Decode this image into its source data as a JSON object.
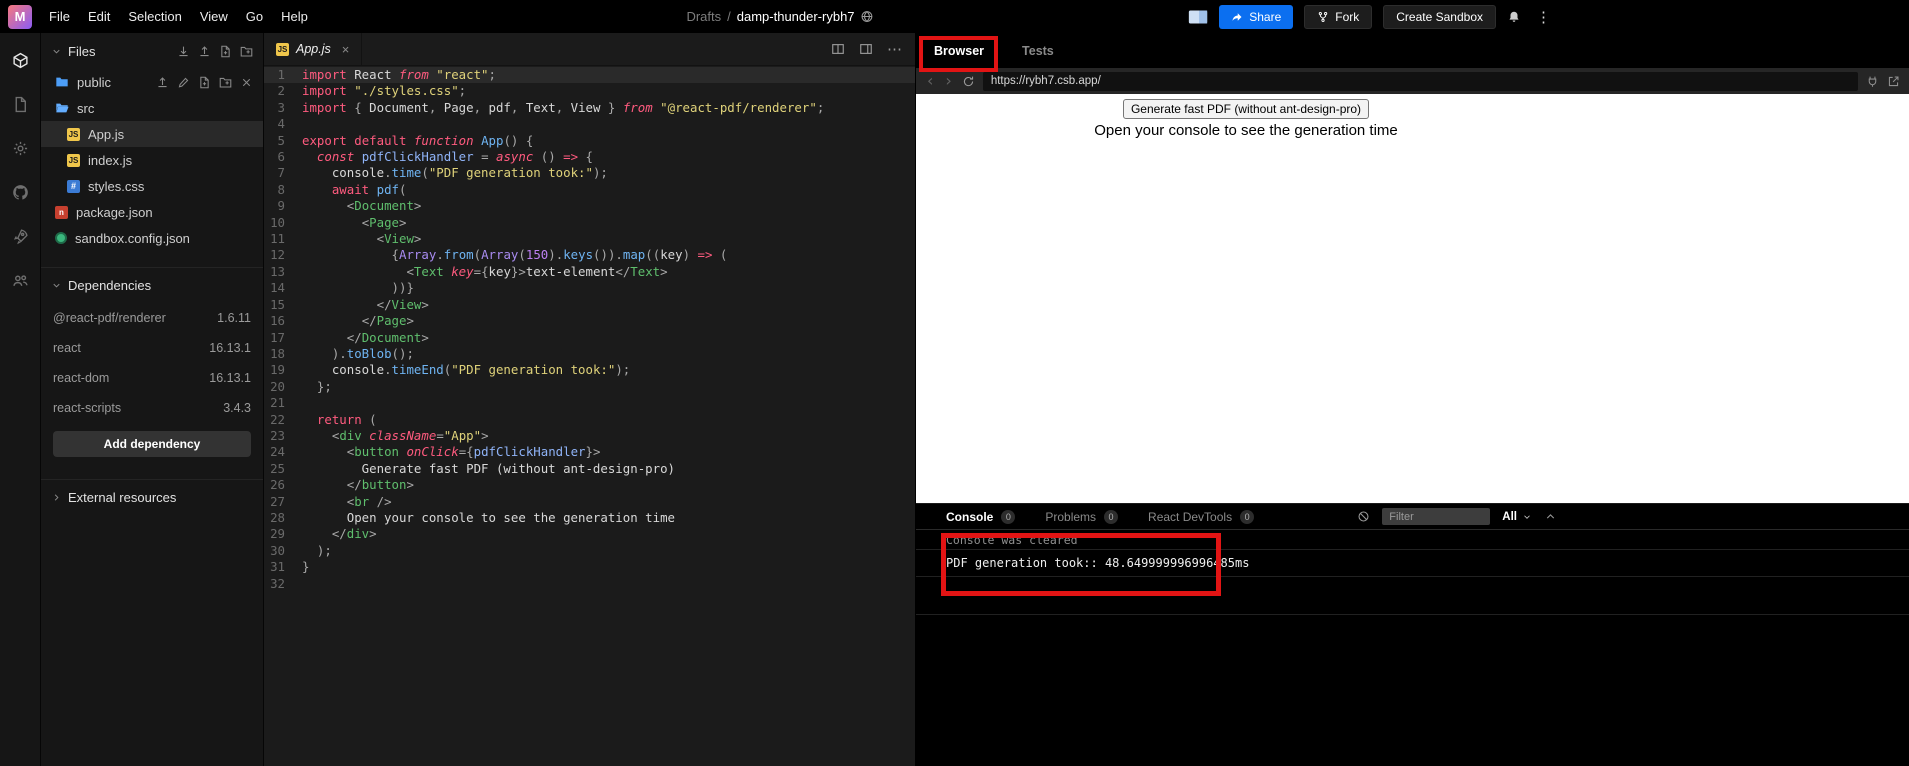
{
  "menubar": {
    "logo_letter": "M",
    "items": [
      "File",
      "Edit",
      "Selection",
      "View",
      "Go",
      "Help"
    ],
    "breadcrumb": {
      "dir": "Drafts",
      "sep": "/",
      "title": "damp-thunder-rybh7"
    },
    "share_label": "Share",
    "fork_label": "Fork",
    "create_sandbox_label": "Create Sandbox"
  },
  "activity_bar": [
    "explorer",
    "files",
    "settings",
    "github",
    "deployment",
    "live"
  ],
  "sidebar": {
    "files_title": "Files",
    "header_actions": [
      "download",
      "upload",
      "new-file",
      "new-folder"
    ],
    "file_row_actions": [
      "upload",
      "rename",
      "new-file",
      "new-folder",
      "delete"
    ],
    "tree": [
      {
        "label": "public",
        "icon": "folder",
        "indent": 0,
        "show_actions": true
      },
      {
        "label": "src",
        "icon": "folder-open",
        "indent": 0
      },
      {
        "label": "App.js",
        "icon": "js",
        "indent": 1,
        "selected": true
      },
      {
        "label": "index.js",
        "icon": "js",
        "indent": 1
      },
      {
        "label": "styles.css",
        "icon": "css",
        "indent": 1
      },
      {
        "label": "package.json",
        "icon": "npm",
        "indent": 0
      },
      {
        "label": "sandbox.config.json",
        "icon": "config",
        "indent": 0
      }
    ],
    "dependencies_title": "Dependencies",
    "dependencies": [
      {
        "name": "@react-pdf/renderer",
        "version": "1.6.11"
      },
      {
        "name": "react",
        "version": "16.13.1"
      },
      {
        "name": "react-dom",
        "version": "16.13.1"
      },
      {
        "name": "react-scripts",
        "version": "3.4.3"
      }
    ],
    "add_dependency_label": "Add dependency",
    "external_resources_title": "External resources"
  },
  "editor": {
    "tab_label": "App.js",
    "line_count": 32,
    "active_line": 1,
    "code": [
      [
        [
          "k",
          "import"
        ],
        [
          "p",
          " React "
        ],
        [
          "ki",
          "from"
        ],
        [
          "p",
          " "
        ],
        [
          "s",
          "\"react\""
        ],
        [
          "d",
          ";"
        ]
      ],
      [
        [
          "k",
          "import"
        ],
        [
          "p",
          " "
        ],
        [
          "s",
          "\"./styles.css\""
        ],
        [
          "d",
          ";"
        ]
      ],
      [
        [
          "k",
          "import"
        ],
        [
          "d",
          " { "
        ],
        [
          "p",
          "Document"
        ],
        [
          "d",
          ", "
        ],
        [
          "p",
          "Page"
        ],
        [
          "d",
          ", "
        ],
        [
          "p",
          "pdf"
        ],
        [
          "d",
          ", "
        ],
        [
          "p",
          "Text"
        ],
        [
          "d",
          ", "
        ],
        [
          "p",
          "View"
        ],
        [
          "d",
          " } "
        ],
        [
          "ki",
          "from"
        ],
        [
          "p",
          " "
        ],
        [
          "s",
          "\"@react-pdf/renderer\""
        ],
        [
          "d",
          ";"
        ]
      ],
      [],
      [
        [
          "k",
          "export"
        ],
        [
          "p",
          " "
        ],
        [
          "k",
          "default"
        ],
        [
          "p",
          " "
        ],
        [
          "ki",
          "function"
        ],
        [
          "p",
          " "
        ],
        [
          "f",
          "App"
        ],
        [
          "d",
          "() {"
        ]
      ],
      [
        [
          "p",
          "  "
        ],
        [
          "ki",
          "const"
        ],
        [
          "p",
          " "
        ],
        [
          "v",
          "pdfClickHandler"
        ],
        [
          "d",
          " = "
        ],
        [
          "ki",
          "async"
        ],
        [
          "d",
          " () "
        ],
        [
          "k",
          "=>"
        ],
        [
          "d",
          " {"
        ]
      ],
      [
        [
          "p",
          "    console"
        ],
        [
          "d",
          "."
        ],
        [
          "f",
          "time"
        ],
        [
          "d",
          "("
        ],
        [
          "s",
          "\"PDF generation took:\""
        ],
        [
          "d",
          ");"
        ]
      ],
      [
        [
          "p",
          "    "
        ],
        [
          "k",
          "await"
        ],
        [
          "p",
          " "
        ],
        [
          "f",
          "pdf"
        ],
        [
          "d",
          "("
        ]
      ],
      [
        [
          "p",
          "      "
        ],
        [
          "d",
          "<"
        ],
        [
          "t",
          "Document"
        ],
        [
          "d",
          ">"
        ]
      ],
      [
        [
          "p",
          "        "
        ],
        [
          "d",
          "<"
        ],
        [
          "t",
          "Page"
        ],
        [
          "d",
          ">"
        ]
      ],
      [
        [
          "p",
          "          "
        ],
        [
          "d",
          "<"
        ],
        [
          "t",
          "View"
        ],
        [
          "d",
          ">"
        ]
      ],
      [
        [
          "p",
          "            "
        ],
        [
          "d",
          "{"
        ],
        [
          "b",
          "Array"
        ],
        [
          "d",
          "."
        ],
        [
          "f",
          "from"
        ],
        [
          "d",
          "("
        ],
        [
          "b",
          "Array"
        ],
        [
          "d",
          "("
        ],
        [
          "n",
          "150"
        ],
        [
          "d",
          ")."
        ],
        [
          "f",
          "keys"
        ],
        [
          "d",
          "())."
        ],
        [
          "f",
          "map"
        ],
        [
          "d",
          "(("
        ],
        [
          "p",
          "key"
        ],
        [
          "d",
          ") "
        ],
        [
          "k",
          "=>"
        ],
        [
          "d",
          " ("
        ]
      ],
      [
        [
          "p",
          "              "
        ],
        [
          "d",
          "<"
        ],
        [
          "t",
          "Text"
        ],
        [
          "p",
          " "
        ],
        [
          "a",
          "key"
        ],
        [
          "d",
          "={"
        ],
        [
          "p",
          "key"
        ],
        [
          "d",
          "}>"
        ],
        [
          "x",
          "text-element"
        ],
        [
          "d",
          "</"
        ],
        [
          "t",
          "Text"
        ],
        [
          "d",
          ">"
        ]
      ],
      [
        [
          "p",
          "            "
        ],
        [
          "d",
          "))}"
        ]
      ],
      [
        [
          "p",
          "          "
        ],
        [
          "d",
          "</"
        ],
        [
          "t",
          "View"
        ],
        [
          "d",
          ">"
        ]
      ],
      [
        [
          "p",
          "        "
        ],
        [
          "d",
          "</"
        ],
        [
          "t",
          "Page"
        ],
        [
          "d",
          ">"
        ]
      ],
      [
        [
          "p",
          "      "
        ],
        [
          "d",
          "</"
        ],
        [
          "t",
          "Document"
        ],
        [
          "d",
          ">"
        ]
      ],
      [
        [
          "p",
          "    "
        ],
        [
          "d",
          ")."
        ],
        [
          "f",
          "toBlob"
        ],
        [
          "d",
          "();"
        ]
      ],
      [
        [
          "p",
          "    console"
        ],
        [
          "d",
          "."
        ],
        [
          "f",
          "timeEnd"
        ],
        [
          "d",
          "("
        ],
        [
          "s",
          "\"PDF generation took:\""
        ],
        [
          "d",
          ");"
        ]
      ],
      [
        [
          "p",
          "  "
        ],
        [
          "d",
          "};"
        ]
      ],
      [],
      [
        [
          "p",
          "  "
        ],
        [
          "k",
          "return"
        ],
        [
          "d",
          " ("
        ]
      ],
      [
        [
          "p",
          "    "
        ],
        [
          "d",
          "<"
        ],
        [
          "t",
          "div"
        ],
        [
          "p",
          " "
        ],
        [
          "a",
          "className"
        ],
        [
          "d",
          "="
        ],
        [
          "s",
          "\"App\""
        ],
        [
          "d",
          ">"
        ]
      ],
      [
        [
          "p",
          "      "
        ],
        [
          "d",
          "<"
        ],
        [
          "t",
          "button"
        ],
        [
          "p",
          " "
        ],
        [
          "a",
          "onClick"
        ],
        [
          "d",
          "={"
        ],
        [
          "v",
          "pdfClickHandler"
        ],
        [
          "d",
          "}>"
        ]
      ],
      [
        [
          "x",
          "        Generate fast PDF (without ant-design-pro)"
        ]
      ],
      [
        [
          "p",
          "      "
        ],
        [
          "d",
          "</"
        ],
        [
          "t",
          "button"
        ],
        [
          "d",
          ">"
        ]
      ],
      [
        [
          "p",
          "      "
        ],
        [
          "d",
          "<"
        ],
        [
          "t",
          "br"
        ],
        [
          "d",
          " />"
        ]
      ],
      [
        [
          "x",
          "      Open your console to see the generation time"
        ]
      ],
      [
        [
          "p",
          "    "
        ],
        [
          "d",
          "</"
        ],
        [
          "t",
          "div"
        ],
        [
          "d",
          ">"
        ]
      ],
      [
        [
          "p",
          "  "
        ],
        [
          "d",
          ");"
        ]
      ],
      [
        [
          "d",
          "}"
        ]
      ],
      []
    ]
  },
  "preview": {
    "tabs": [
      {
        "label": "Browser",
        "active": true
      },
      {
        "label": "Tests",
        "active": false
      }
    ],
    "nav": {
      "url": "https://rybh7.csb.app/"
    },
    "app": {
      "button_label": "Generate fast PDF (without ant-design-pro)",
      "caption": "Open your console to see the generation time"
    },
    "console": {
      "tabs": [
        {
          "label": "Console",
          "badge": "0",
          "active": true
        },
        {
          "label": "Problems",
          "badge": "0",
          "active": false
        },
        {
          "label": "React DevTools",
          "badge": "0",
          "active": false
        }
      ],
      "filter_placeholder": "Filter",
      "level_label": "All",
      "entries": [
        {
          "text": "Console was cleared",
          "kind": "muted"
        },
        {
          "text": "PDF generation took:: 48.649999996996485ms",
          "kind": "log"
        }
      ]
    }
  }
}
